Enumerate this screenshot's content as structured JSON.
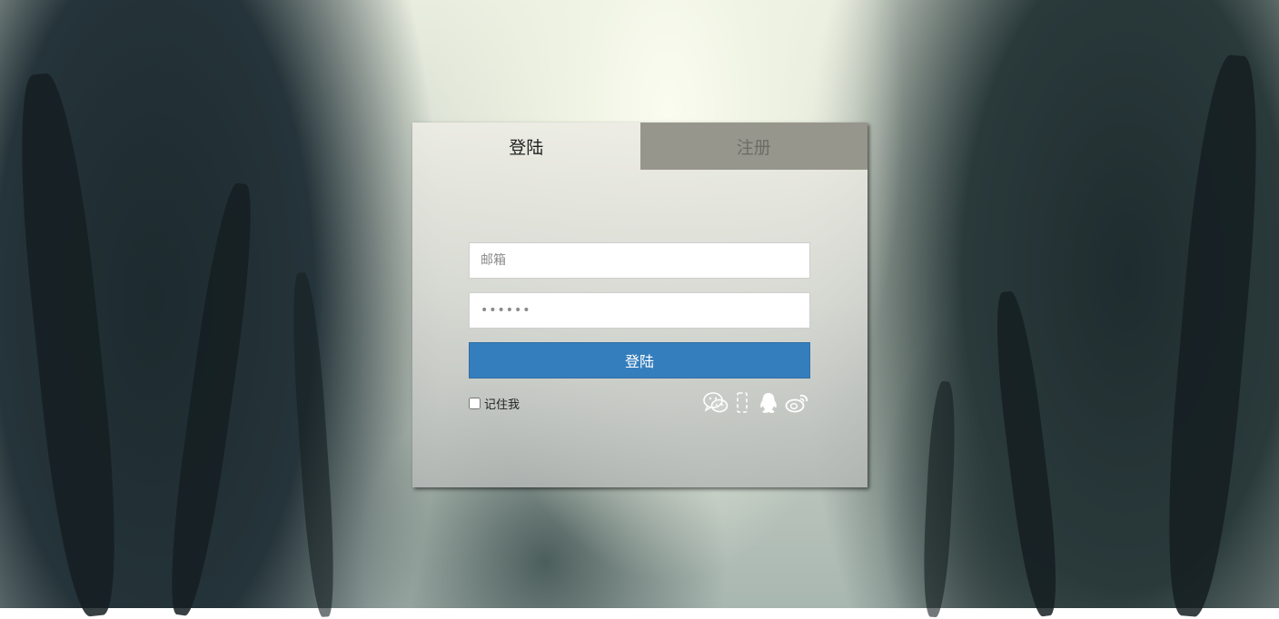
{
  "tabs": {
    "login_label": "登陆",
    "register_label": "注册"
  },
  "form": {
    "email_placeholder": "邮箱",
    "password_placeholder": "••••••",
    "submit_label": "登陆",
    "remember_label": "记住我",
    "remember_checked": false
  },
  "social": {
    "icons": [
      "wechat-icon",
      "mobile-phone-icon",
      "qq-icon",
      "weibo-icon"
    ]
  },
  "colors": {
    "primary_button": "#357ebd",
    "inactive_tab": "#97968c"
  }
}
